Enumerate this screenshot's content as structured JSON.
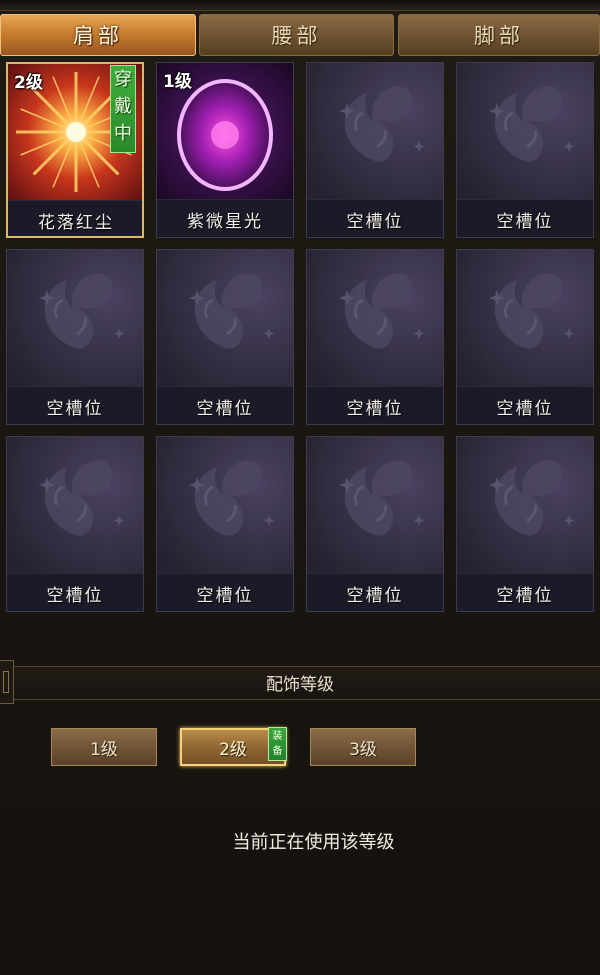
{
  "tabs": [
    {
      "label": "肩部",
      "active": true
    },
    {
      "label": "腰部",
      "active": false
    },
    {
      "label": "脚部",
      "active": false
    }
  ],
  "slots": [
    {
      "name": "花落红尘",
      "level": "2级",
      "worn_badge": "穿戴中",
      "art": "red-burst-icon"
    },
    {
      "name": "紫微星光",
      "level": "1级",
      "art": "purple-orb-icon"
    },
    {
      "name": "空槽位"
    },
    {
      "name": "空槽位"
    },
    {
      "name": "空槽位"
    },
    {
      "name": "空槽位"
    },
    {
      "name": "空槽位"
    },
    {
      "name": "空槽位"
    },
    {
      "name": "空槽位"
    },
    {
      "name": "空槽位"
    },
    {
      "name": "空槽位"
    },
    {
      "name": "空槽位"
    }
  ],
  "section": {
    "title": "配饰等级"
  },
  "level_buttons": [
    {
      "label": "1级",
      "active": false
    },
    {
      "label": "2级",
      "active": true
    },
    {
      "label": "3级",
      "active": false
    }
  ],
  "equip_tag": "装备",
  "status": "当前正在使用该等级",
  "colors": {
    "tab_active": "#c57a2e",
    "tab_inactive": "#6d5232",
    "badge_green": "#2a8a2a",
    "slot_bg": "#2b2738",
    "selected_border": "#d9b870"
  }
}
